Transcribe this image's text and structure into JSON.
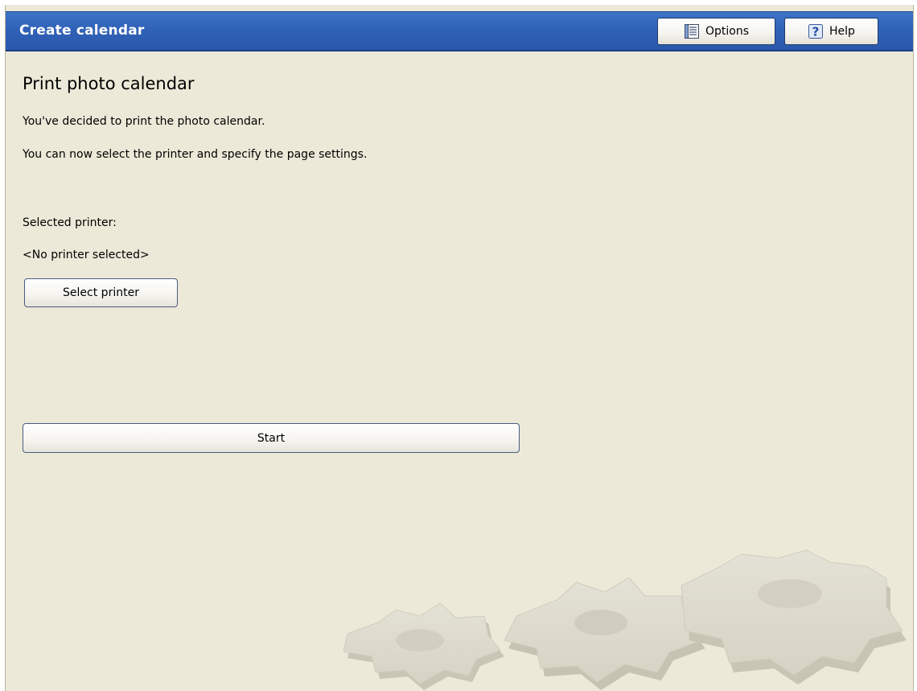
{
  "window": {
    "title": "Create calendar",
    "options_label": "Options",
    "help_label": "Help"
  },
  "main": {
    "heading": "Print photo calendar",
    "line1": "You've decided to print the photo calendar.",
    "line2": "You can now select the printer and specify the page settings.",
    "printer_label": "Selected printer:",
    "printer_value": "<No printer selected>",
    "select_printer_label": "Select printer",
    "start_label": "Start"
  },
  "icons": {
    "options": "options-list-icon",
    "help": "help-question-icon",
    "decoration": "gears-decoration"
  },
  "colors": {
    "titlebar": "#2f62b8",
    "background": "#ece9d8",
    "title_text": "#ffffff"
  }
}
